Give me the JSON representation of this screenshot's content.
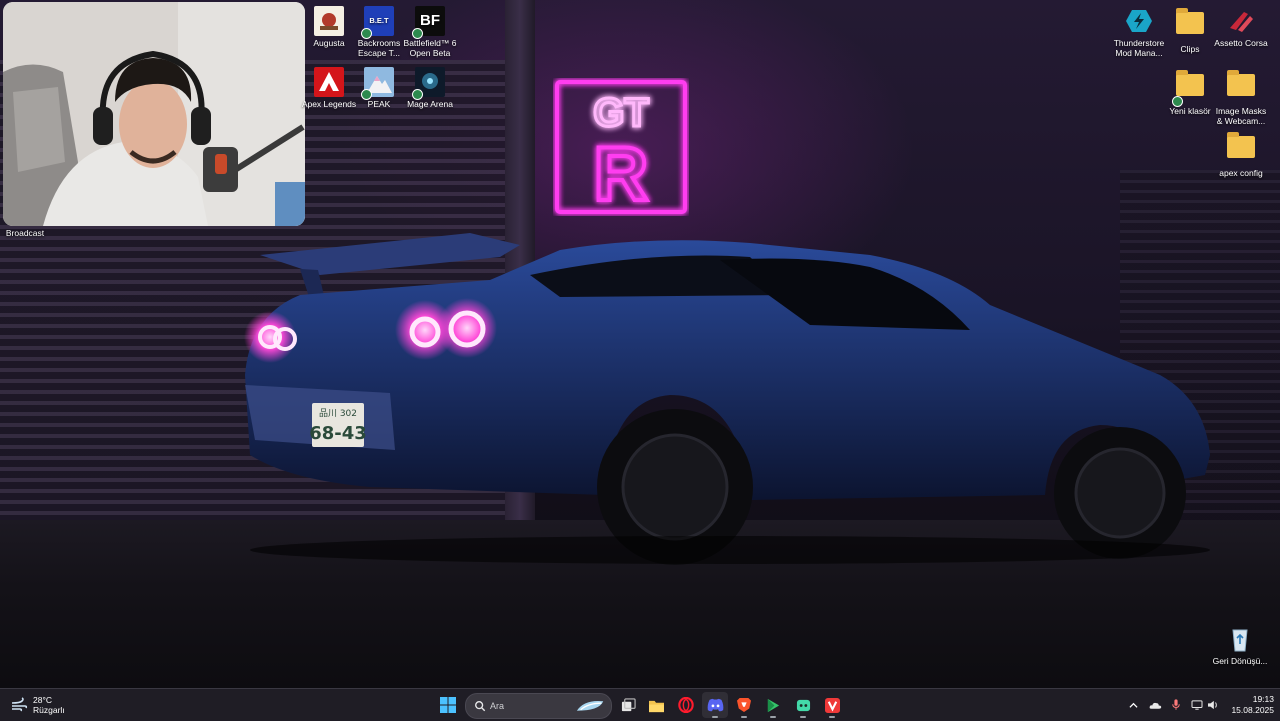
{
  "desktop": {
    "icons": [
      {
        "label": "Augusta"
      },
      {
        "label": "Backrooms Escape T..."
      },
      {
        "label": "Battlefield™ 6 Open Beta"
      },
      {
        "label": "Apex Legends"
      },
      {
        "label": "PEAK"
      },
      {
        "label": "Mage Arena"
      },
      {
        "label": "Thunderstore Mod Mana..."
      },
      {
        "label": "Clips"
      },
      {
        "label": "Assetto Corsa"
      },
      {
        "label": "Yeni klasör"
      },
      {
        "label": "Image Masks & Webcam..."
      },
      {
        "label": "apex config"
      },
      {
        "label": "Geri Dönüşü..."
      }
    ],
    "partial_label": "Broadcast",
    "glyph_text": {
      "backrooms": "B.E.T",
      "battlefield": "BF",
      "neon_top": "GT",
      "neon_bottom": "R",
      "plate_top": "品川 302",
      "plate_bottom": "68-43"
    }
  },
  "taskbar": {
    "weather": {
      "temp": "28°C",
      "condition": "Rüzgarlı"
    },
    "search": {
      "placeholder": "Ara"
    },
    "clock": {
      "time": "19:13",
      "date": "15.08.2025"
    }
  },
  "colors": {
    "neon": "#ff3cf0",
    "car_body": "#1b2f66",
    "taillight": "#ff4ad8",
    "taskbar": "#201e26",
    "folder": "#f3c34f"
  }
}
